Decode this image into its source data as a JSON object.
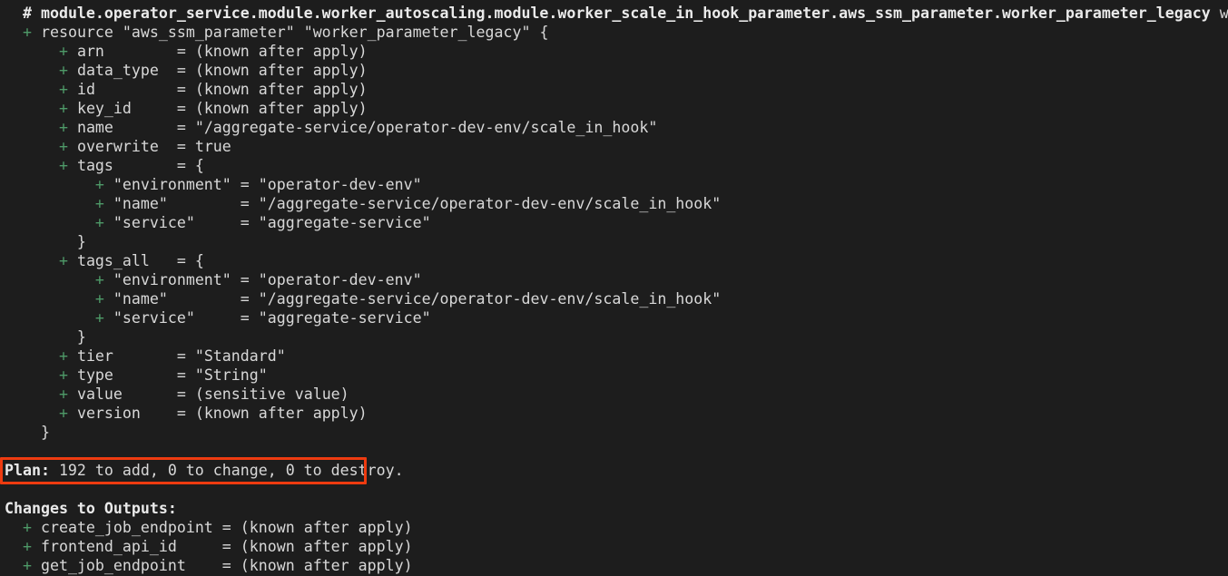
{
  "terminal": {
    "background_color": "#1d1d1d",
    "foreground_color": "#d8d8d8",
    "add_marker_color": "#4e9a68",
    "highlight_box_color": "#ee3b10",
    "font": "monospace"
  },
  "plan": {
    "resource_header": {
      "marker": "#",
      "address": "module.operator_service.module.worker_autoscaling.module.worker_scale_in_hook_parameter.aws_ssm_parameter.worker_parameter_legacy",
      "action_text": "will be created",
      "full_line": "  # module.operator_service.module.worker_autoscaling.module.worker_scale_in_hook_parameter.aws_ssm_parameter.worker_parameter_legacy will be created"
    },
    "resource_open": {
      "marker": "+",
      "text": "resource \"aws_ssm_parameter\" \"worker_parameter_legacy\" {"
    },
    "attributes": [
      {
        "marker": "+",
        "text": "arn        = (known after apply)"
      },
      {
        "marker": "+",
        "text": "data_type  = (known after apply)"
      },
      {
        "marker": "+",
        "text": "id         = (known after apply)"
      },
      {
        "marker": "+",
        "text": "key_id     = (known after apply)"
      },
      {
        "marker": "+",
        "text": "name       = \"/aggregate-service/operator-dev-env/scale_in_hook\""
      },
      {
        "marker": "+",
        "text": "overwrite  = true"
      },
      {
        "marker": "+",
        "text": "tags       = {"
      }
    ],
    "tags_block": [
      {
        "marker": "+",
        "text": "\"environment\" = \"operator-dev-env\""
      },
      {
        "marker": "+",
        "text": "\"name\"        = \"/aggregate-service/operator-dev-env/scale_in_hook\""
      },
      {
        "marker": "+",
        "text": "\"service\"     = \"aggregate-service\""
      }
    ],
    "tags_close": "  }",
    "tags_all_open": {
      "marker": "+",
      "text": "tags_all   = {"
    },
    "tags_all_block": [
      {
        "marker": "+",
        "text": "\"environment\" = \"operator-dev-env\""
      },
      {
        "marker": "+",
        "text": "\"name\"        = \"/aggregate-service/operator-dev-env/scale_in_hook\""
      },
      {
        "marker": "+",
        "text": "\"service\"     = \"aggregate-service\""
      }
    ],
    "tags_all_close": "  }",
    "attributes_tail": [
      {
        "marker": "+",
        "text": "tier       = \"Standard\""
      },
      {
        "marker": "+",
        "text": "type       = \"String\""
      },
      {
        "marker": "+",
        "text": "value      = (sensitive value)"
      },
      {
        "marker": "+",
        "text": "version    = (known after apply)"
      }
    ],
    "resource_close": "  }"
  },
  "summary": {
    "label": "Plan:",
    "detail": " 192 to add, 0 to change, 0 to destroy.",
    "add_count": 192,
    "change_count": 0,
    "destroy_count": 0,
    "highlighted": true
  },
  "outputs": {
    "heading": "Changes to Outputs:",
    "items": [
      {
        "marker": "+",
        "name": "create_job_endpoint",
        "value": "= (known after apply)",
        "text": "create_job_endpoint = (known after apply)"
      },
      {
        "marker": "+",
        "name": "frontend_api_id",
        "value": "= (known after apply)",
        "text": "frontend_api_id     = (known after apply)"
      },
      {
        "marker": "+",
        "name": "get_job_endpoint",
        "value": "= (known after apply)",
        "text": "get_job_endpoint    = (known after apply)"
      }
    ]
  }
}
